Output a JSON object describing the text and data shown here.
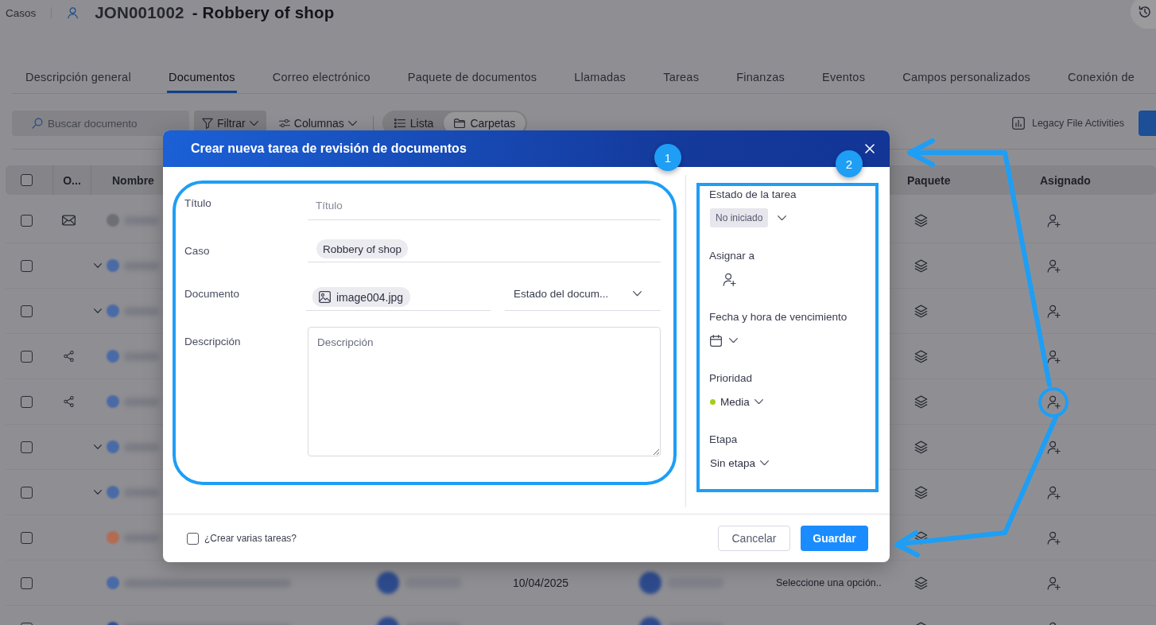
{
  "header": {
    "breadcrumb": "Casos",
    "case_id": "JON001002",
    "case_title": "- Robbery of shop"
  },
  "tabs": [
    {
      "label": "Descripción general",
      "selected": false
    },
    {
      "label": "Documentos",
      "selected": true
    },
    {
      "label": "Correo electrónico",
      "selected": false
    },
    {
      "label": "Paquete de documentos",
      "selected": false
    },
    {
      "label": "Llamadas",
      "selected": false
    },
    {
      "label": "Tareas",
      "selected": false
    },
    {
      "label": "Finanzas",
      "selected": false
    },
    {
      "label": "Eventos",
      "selected": false
    },
    {
      "label": "Campos personalizados",
      "selected": false
    },
    {
      "label": "Conexión de",
      "selected": false
    }
  ],
  "toolbar": {
    "search": {
      "placeholder": "Buscar documento"
    },
    "filter": "Filtrar",
    "columns": "Columnas",
    "views": [
      {
        "label": "Lista",
        "kind": "list",
        "selected": false
      },
      {
        "label": "Carpetas",
        "kind": "folders",
        "selected": true
      }
    ],
    "legacy": "Legacy File Activities"
  },
  "table": {
    "select_all": {
      "checked": false
    },
    "columns": [
      "O...",
      "Nombre",
      "Paquete",
      "Asignado"
    ],
    "rows": [
      {
        "kind": "email",
        "checked": false,
        "color": "#6e6e76"
      },
      {
        "kind": "folder",
        "checked": false,
        "color": "#4a6aa6"
      },
      {
        "kind": "folder",
        "checked": false,
        "color": "#4a6aa6"
      },
      {
        "kind": "shared",
        "checked": false,
        "color": "#4a6aa6"
      },
      {
        "kind": "shared",
        "checked": false,
        "color": "#4a6aa6"
      },
      {
        "kind": "folder",
        "checked": false,
        "color": "#4a6aa6"
      },
      {
        "kind": "folder",
        "checked": false,
        "color": "#4a6aa6"
      },
      {
        "kind": "file",
        "checked": false,
        "color": "#b36b52"
      },
      {
        "kind": "file",
        "checked": false,
        "color": "#4a6aa6",
        "date": "10/04/2025",
        "column_7": "Seleccione una opción.."
      },
      {
        "kind": "file",
        "checked": false,
        "color": "#2e4f90"
      }
    ]
  },
  "modal": {
    "title": "Crear nueva tarea de revisión de documentos",
    "fields": {
      "title": {
        "label": "Título",
        "placeholder": "Título"
      },
      "case": {
        "label": "Caso",
        "value": "Robbery of shop"
      },
      "document": {
        "label": "Documento",
        "value": "image004.jpg",
        "status": {
          "placeholder": "Estado del docum..."
        }
      },
      "description": {
        "label": "Descripción",
        "placeholder": "Descripción"
      }
    },
    "side": {
      "status": {
        "label": "Estado de la tarea",
        "value": "No iniciado"
      },
      "assignee": {
        "label": "Asignar a"
      },
      "due": {
        "label": "Fecha y hora de vencimiento"
      },
      "priority": {
        "label": "Prioridad",
        "value": "Media",
        "color": "#a3cf1b"
      },
      "stage": {
        "label": "Etapa",
        "value": "Sin etapa"
      }
    },
    "multiple": {
      "label": "¿Crear varias tareas?",
      "checked": false
    },
    "buttons": {
      "cancel": "Cancelar",
      "save": "Guardar"
    }
  },
  "annotations": {
    "badges": [
      "1",
      "2"
    ]
  }
}
